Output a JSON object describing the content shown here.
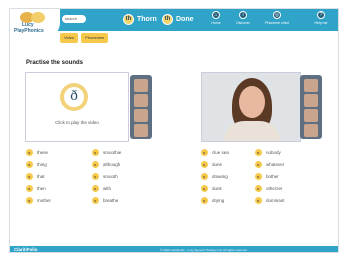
{
  "logo": {
    "line1": "Lucy",
    "line2": "PlayPhonics"
  },
  "search": {
    "placeholder": "search"
  },
  "sound_tabs": [
    {
      "icon": "th",
      "label": "Thorn"
    },
    {
      "icon": "th",
      "label": "Done"
    }
  ],
  "nav": [
    {
      "icon": "home-icon",
      "label": "Home"
    },
    {
      "icon": "discover-icon",
      "label": "Discover"
    },
    {
      "icon": "phonemes-icon",
      "label": "Phoneme chart"
    },
    {
      "icon": "help-icon",
      "label": "Help me"
    }
  ],
  "subtabs": [
    "Video",
    "Phonemes"
  ],
  "heading": "Practise the sounds",
  "video_left": {
    "glyph": "ð",
    "caption": "Click to play the video"
  },
  "words": {
    "col1": [
      "these",
      "thing",
      "that",
      "then",
      "mother"
    ],
    "col2": [
      "smoothie",
      "although",
      "smooth",
      "with",
      "breathe"
    ],
    "col3": [
      "clue sea",
      "dune",
      "drawing",
      "dunk",
      "drying"
    ],
    "col4": [
      "nobody",
      "whatever",
      "bother",
      "otherzer",
      "dominant"
    ]
  },
  "footer": {
    "brand": "ClaritiFolio",
    "copyright": "© 2020 ClaritiFolio · Lucy Speech Therapy Ltd. All rights reserved"
  }
}
